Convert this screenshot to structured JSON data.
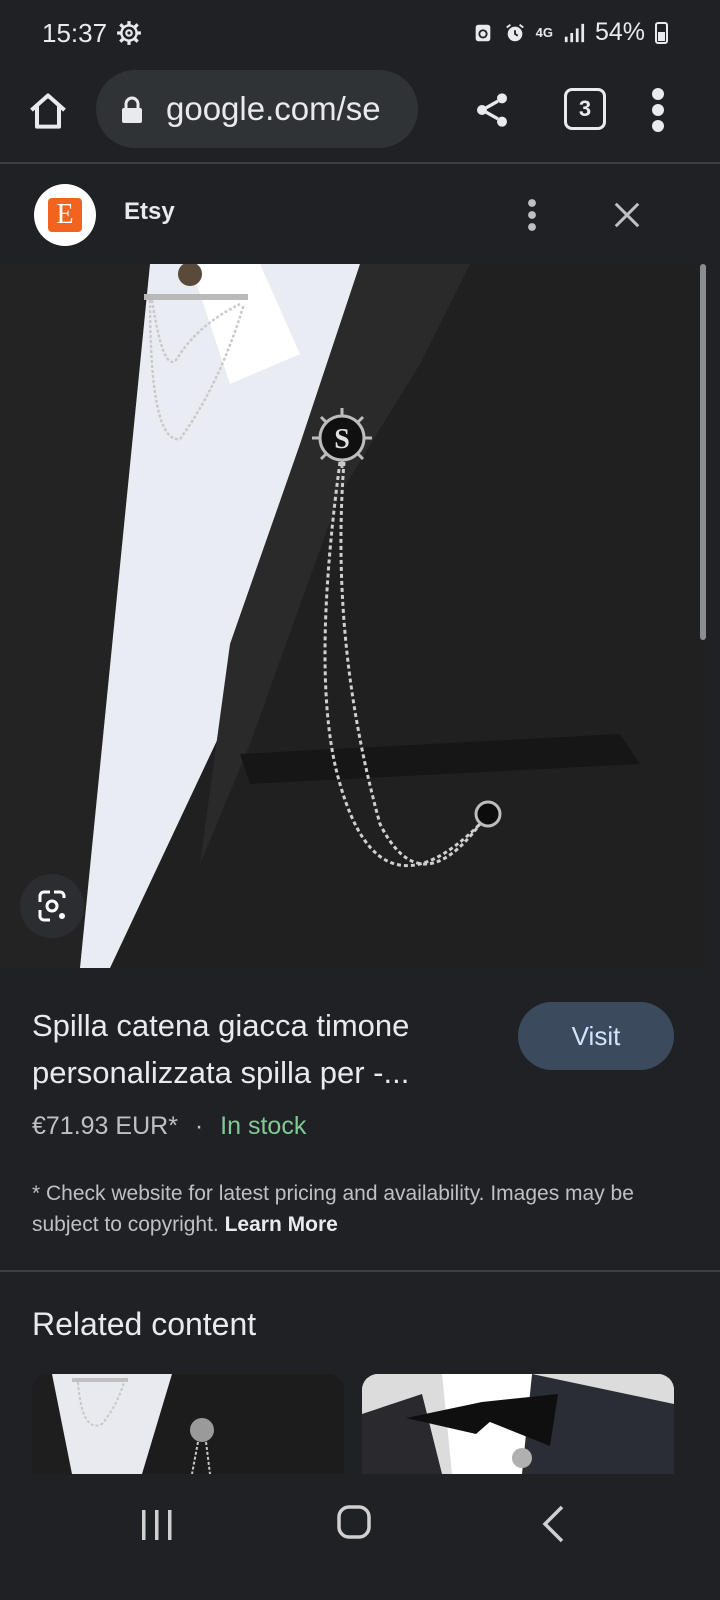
{
  "status_bar": {
    "time": "15:37",
    "network": "4G",
    "battery": "54%",
    "icons": [
      "settings-gear-icon",
      "recycle-icon",
      "alarm-icon",
      "network-4g-icon",
      "signal-icon",
      "battery-icon"
    ]
  },
  "toolbar": {
    "url": "google.com/se",
    "tab_count": "3",
    "icons": [
      "home-icon",
      "lock-icon",
      "share-icon",
      "tabs-icon",
      "more-vert-icon"
    ]
  },
  "panel": {
    "source_name": "Etsy",
    "source_logo_letter": "E",
    "logo_color": "#f1641e"
  },
  "product": {
    "title": "Spilla catena giacca timone personalizzata spilla per -...",
    "visit_label": "Visit",
    "price": "€71.93 EUR*",
    "separator": "·",
    "stock": "In stock",
    "disclaimer": "* Check website for latest pricing and availability. Images may be subject to copyright.",
    "learn_more": "Learn More",
    "pin_letter": "S"
  },
  "related": {
    "title": "Related content"
  },
  "colors": {
    "background": "#202124",
    "visit_button": "#3c4a5e",
    "stock_green": "#81c995"
  }
}
